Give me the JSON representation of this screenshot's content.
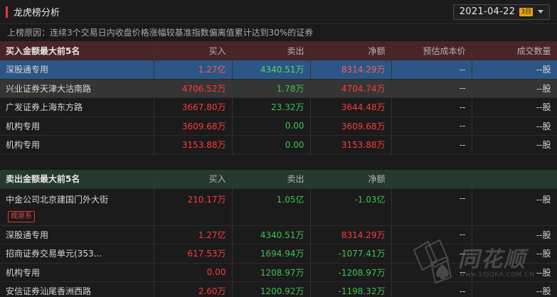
{
  "header": {
    "title": "龙虎榜分析",
    "date": "2021-04-22",
    "day_badge": "3日"
  },
  "reason": "上榜原因：连续3个交易日内收盘价格涨幅较基准指数偏离值累计达到30%的证券",
  "buy_section": {
    "headers": [
      "买入金额最大前5名",
      "买入",
      "卖出",
      "净额",
      "预估成本价",
      "成交数量"
    ],
    "rows": [
      {
        "name": "深股通专用",
        "buy": "1.27亿",
        "sell": "4340.51万",
        "net": "8314.29万",
        "cost": "--",
        "volume": "--股"
      },
      {
        "name": "兴业证券天津大沽南路",
        "buy": "4706.52万",
        "sell": "1.78万",
        "net": "4704.74万",
        "cost": "--",
        "volume": "--股"
      },
      {
        "name": "广发证券上海东方路",
        "buy": "3667.80万",
        "sell": "23.32万",
        "net": "3644.48万",
        "cost": "--",
        "volume": "--股"
      },
      {
        "name": "机构专用",
        "buy": "3609.68万",
        "sell": "0.00",
        "net": "3609.68万",
        "cost": "--",
        "volume": "--股"
      },
      {
        "name": "机构专用",
        "buy": "3153.88万",
        "sell": "0.00",
        "net": "3153.88万",
        "cost": "--",
        "volume": "--股"
      }
    ]
  },
  "sell_section": {
    "headers": [
      "卖出金额最大前5名",
      "买入",
      "卖出",
      "净额",
      "",
      ""
    ],
    "rows": [
      {
        "name": "中金公司北京建国门外大街",
        "tag": "成泉系",
        "buy": "210.17万",
        "sell": "1.05亿",
        "net": "-1.03亿",
        "cost": "--",
        "volume": "--股"
      },
      {
        "name": "深股通专用",
        "buy": "1.27亿",
        "sell": "4340.51万",
        "net": "8314.29万",
        "cost": "--",
        "volume": "--股"
      },
      {
        "name": "招商证券交易单元(353...",
        "buy": "617.53万",
        "sell": "1694.94万",
        "net": "-1077.41万",
        "cost": "--",
        "volume": "--股"
      },
      {
        "name": "机构专用",
        "buy": "0.00",
        "sell": "1208.97万",
        "net": "-1208.97万",
        "cost": "--",
        "volume": "--股"
      },
      {
        "name": "安信证券汕尾香洲西路",
        "buy": "2.60万",
        "sell": "1200.92万",
        "net": "-1198.32万",
        "cost": "--",
        "volume": "--股"
      }
    ]
  },
  "watermark": {
    "brand": "同花顺",
    "url": "www.10JQKA.COM.CN"
  },
  "colors": {
    "up": "#ff3b3b",
    "down": "#3fc34f",
    "selected_row": "#2c5687",
    "buy_header": "#4a2526",
    "sell_header": "#253a2c",
    "title_accent": "#e03c31",
    "badge": "#e8a317"
  }
}
